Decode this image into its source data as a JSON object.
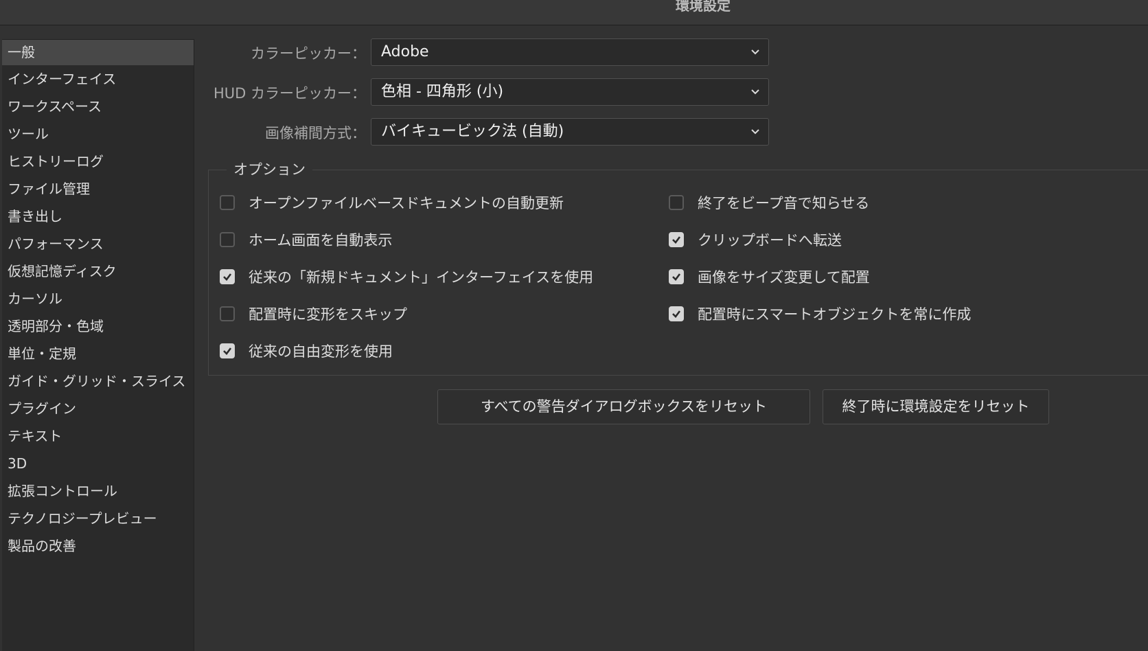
{
  "window": {
    "title": "環境設定"
  },
  "sidebar": {
    "items": [
      {
        "label": "一般"
      },
      {
        "label": "インターフェイス"
      },
      {
        "label": "ワークスペース"
      },
      {
        "label": "ツール"
      },
      {
        "label": "ヒストリーログ"
      },
      {
        "label": "ファイル管理"
      },
      {
        "label": "書き出し"
      },
      {
        "label": "パフォーマンス"
      },
      {
        "label": "仮想記憶ディスク"
      },
      {
        "label": "カーソル"
      },
      {
        "label": "透明部分・色域"
      },
      {
        "label": "単位・定規"
      },
      {
        "label": "ガイド・グリッド・スライス"
      },
      {
        "label": "プラグイン"
      },
      {
        "label": "テキスト"
      },
      {
        "label": "3D"
      },
      {
        "label": "拡張コントロール"
      },
      {
        "label": "テクノロジープレビュー"
      },
      {
        "label": "製品の改善"
      }
    ],
    "selected_index": 0
  },
  "settings": {
    "color_picker": {
      "label": "カラーピッカー：",
      "value": "Adobe"
    },
    "hud_color_picker": {
      "label": "HUD カラーピッカー：",
      "value": "色相 - 四角形 (小)"
    },
    "interpolation": {
      "label": "画像補間方式：",
      "value": "バイキュービック法 (自動)"
    }
  },
  "options": {
    "legend": "オプション",
    "left": [
      {
        "label": "オープンファイルベースドキュメントの自動更新",
        "checked": false
      },
      {
        "label": "ホーム画面を自動表示",
        "checked": false
      },
      {
        "label": "従来の「新規ドキュメント」インターフェイスを使用",
        "checked": true
      },
      {
        "label": "配置時に変形をスキップ",
        "checked": false
      },
      {
        "label": "従来の自由変形を使用",
        "checked": true
      }
    ],
    "right": [
      {
        "label": "終了をビープ音で知らせる",
        "checked": false
      },
      {
        "label": "クリップボードへ転送",
        "checked": true
      },
      {
        "label": "画像をサイズ変更して配置",
        "checked": true
      },
      {
        "label": "配置時にスマートオブジェクトを常に作成",
        "checked": true
      }
    ]
  },
  "buttons": {
    "reset_warnings": "すべての警告ダイアログボックスをリセット",
    "reset_prefs_on_quit": "終了時に環境設定をリセット"
  },
  "icons": {
    "dropdown": "chevron-down-icon",
    "check": "checkmark-icon"
  },
  "colors": {
    "background": "#323232",
    "sidebar_bg": "#2a2a2a",
    "sidebar_selected": "#484848",
    "checkbox_checked": "#d6d6d6"
  }
}
